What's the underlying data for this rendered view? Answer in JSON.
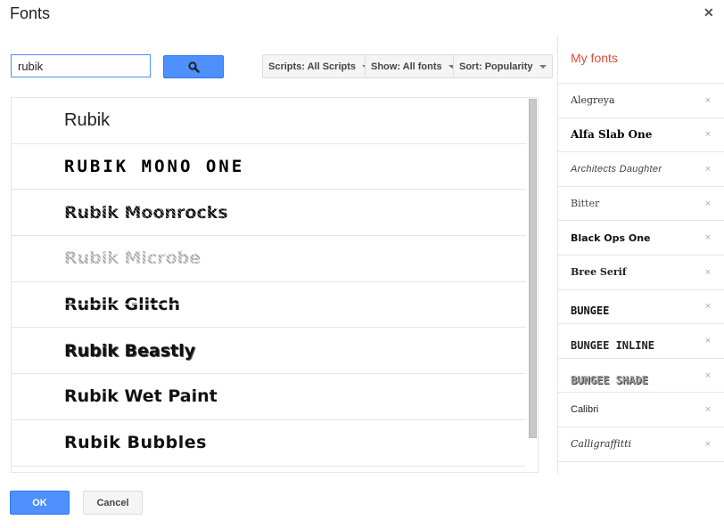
{
  "dialog": {
    "title": "Fonts",
    "close_icon": "close-icon"
  },
  "search": {
    "value": "rubik",
    "button_icon": "search-icon"
  },
  "filters": {
    "scripts": "Scripts: All Scripts",
    "show": "Show: All fonts",
    "sort": "Sort: Popularity"
  },
  "results": [
    {
      "name": "Rubik"
    },
    {
      "name": "RUBIK MONO ONE"
    },
    {
      "name": "Rubik Moonrocks"
    },
    {
      "name": "Rubik Microbe"
    },
    {
      "name": "Rubik Glitch"
    },
    {
      "name": "Rubik Beastly"
    },
    {
      "name": "Rubik Wet Paint"
    },
    {
      "name": "Rubik Bubbles"
    }
  ],
  "my_fonts": {
    "title": "My fonts",
    "items": [
      {
        "name": "Alegreya"
      },
      {
        "name": "Alfa Slab One"
      },
      {
        "name": "Architects Daughter"
      },
      {
        "name": "Bitter"
      },
      {
        "name": "Black Ops One"
      },
      {
        "name": "Bree Serif"
      },
      {
        "name": "BUNGEE"
      },
      {
        "name": "BUNGEE INLINE"
      },
      {
        "name": "BUNGEE SHADE"
      },
      {
        "name": "Calibri"
      },
      {
        "name": "Calligraffitti"
      }
    ],
    "remove_glyph": "×"
  },
  "footer": {
    "ok_label": "OK",
    "cancel_label": "Cancel"
  },
  "colors": {
    "accent_blue": "#4d90fe",
    "my_fonts_title": "#dd4b39"
  }
}
